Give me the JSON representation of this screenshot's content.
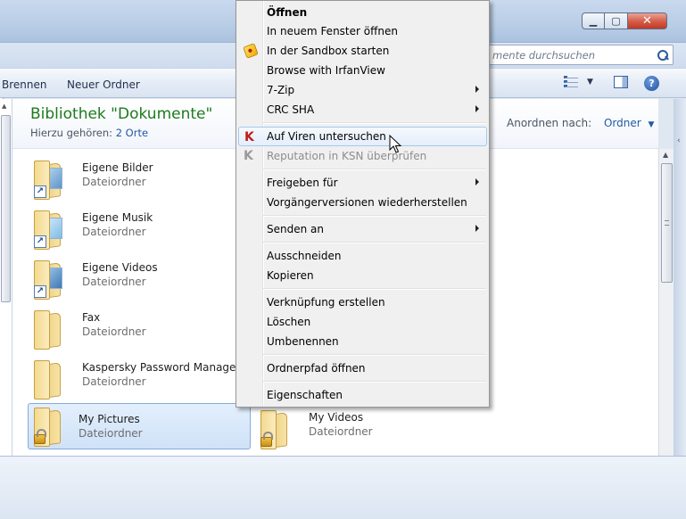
{
  "window": {
    "search_placeholder": "mente durchsuchen",
    "buttons": {
      "minimize": "▁",
      "maximize": "▢",
      "close": "✕"
    }
  },
  "toolbar": {
    "burn": "Brennen",
    "new_folder": "Neuer Ordner"
  },
  "library": {
    "title": "Bibliothek \"Dokumente\"",
    "includes_label": "Hierzu gehören:",
    "includes_link": "2 Orte",
    "arrange_label": "Anordnen nach:",
    "arrange_value": "Ordner"
  },
  "files": [
    {
      "name": "Eigene Bilder",
      "type": "Dateiordner",
      "icon": "pictures-folder-icon",
      "overlay": "shortcut"
    },
    {
      "name": "Eigene Musik",
      "type": "Dateiordner",
      "icon": "music-folder-icon",
      "overlay": "shortcut"
    },
    {
      "name": "Eigene Videos",
      "type": "Dateiordner",
      "icon": "videos-folder-icon",
      "overlay": "shortcut"
    },
    {
      "name": "Fax",
      "type": "Dateiordner",
      "icon": "folder-icon",
      "overlay": "none"
    },
    {
      "name": "Kaspersky Password Manager",
      "type": "Dateiordner",
      "icon": "folder-icon",
      "overlay": "none"
    },
    {
      "name": "My Pictures",
      "type": "Dateiordner",
      "icon": "folder-icon",
      "overlay": "lock",
      "selected": true
    },
    {
      "name": "My Videos",
      "type": "Dateiordner",
      "icon": "folder-icon",
      "overlay": "lock"
    }
  ],
  "context_menu": {
    "items": [
      {
        "label": "Öffnen",
        "bold": true
      },
      {
        "label": "In neuem Fenster öffnen"
      },
      {
        "label": "In der Sandbox starten",
        "icon": "sandboxie-icon"
      },
      {
        "label": "Browse with IrfanView"
      },
      {
        "label": "7-Zip",
        "submenu": true
      },
      {
        "label": "CRC SHA",
        "submenu": true
      },
      {
        "label": "Auf Viren untersuchen",
        "icon": "kaspersky-icon",
        "highlighted": true
      },
      {
        "label": "Reputation in KSN überprüfen",
        "icon": "kaspersky-gray-icon",
        "disabled": true
      },
      {
        "label": "Freigeben für",
        "submenu": true
      },
      {
        "label": "Vorgängerversionen wiederherstellen"
      },
      {
        "label": "Senden an",
        "submenu": true
      },
      {
        "label": "Ausschneiden"
      },
      {
        "label": "Kopieren"
      },
      {
        "label": "Verknüpfung erstellen"
      },
      {
        "label": "Löschen"
      },
      {
        "label": "Umbenennen"
      },
      {
        "label": "Ordnerpfad öffnen"
      },
      {
        "label": "Eigenschaften"
      }
    ]
  },
  "colors": {
    "library_title": "#1e7a1e",
    "link": "#2359a8",
    "menu_highlight_border": "#a8c8ec"
  }
}
